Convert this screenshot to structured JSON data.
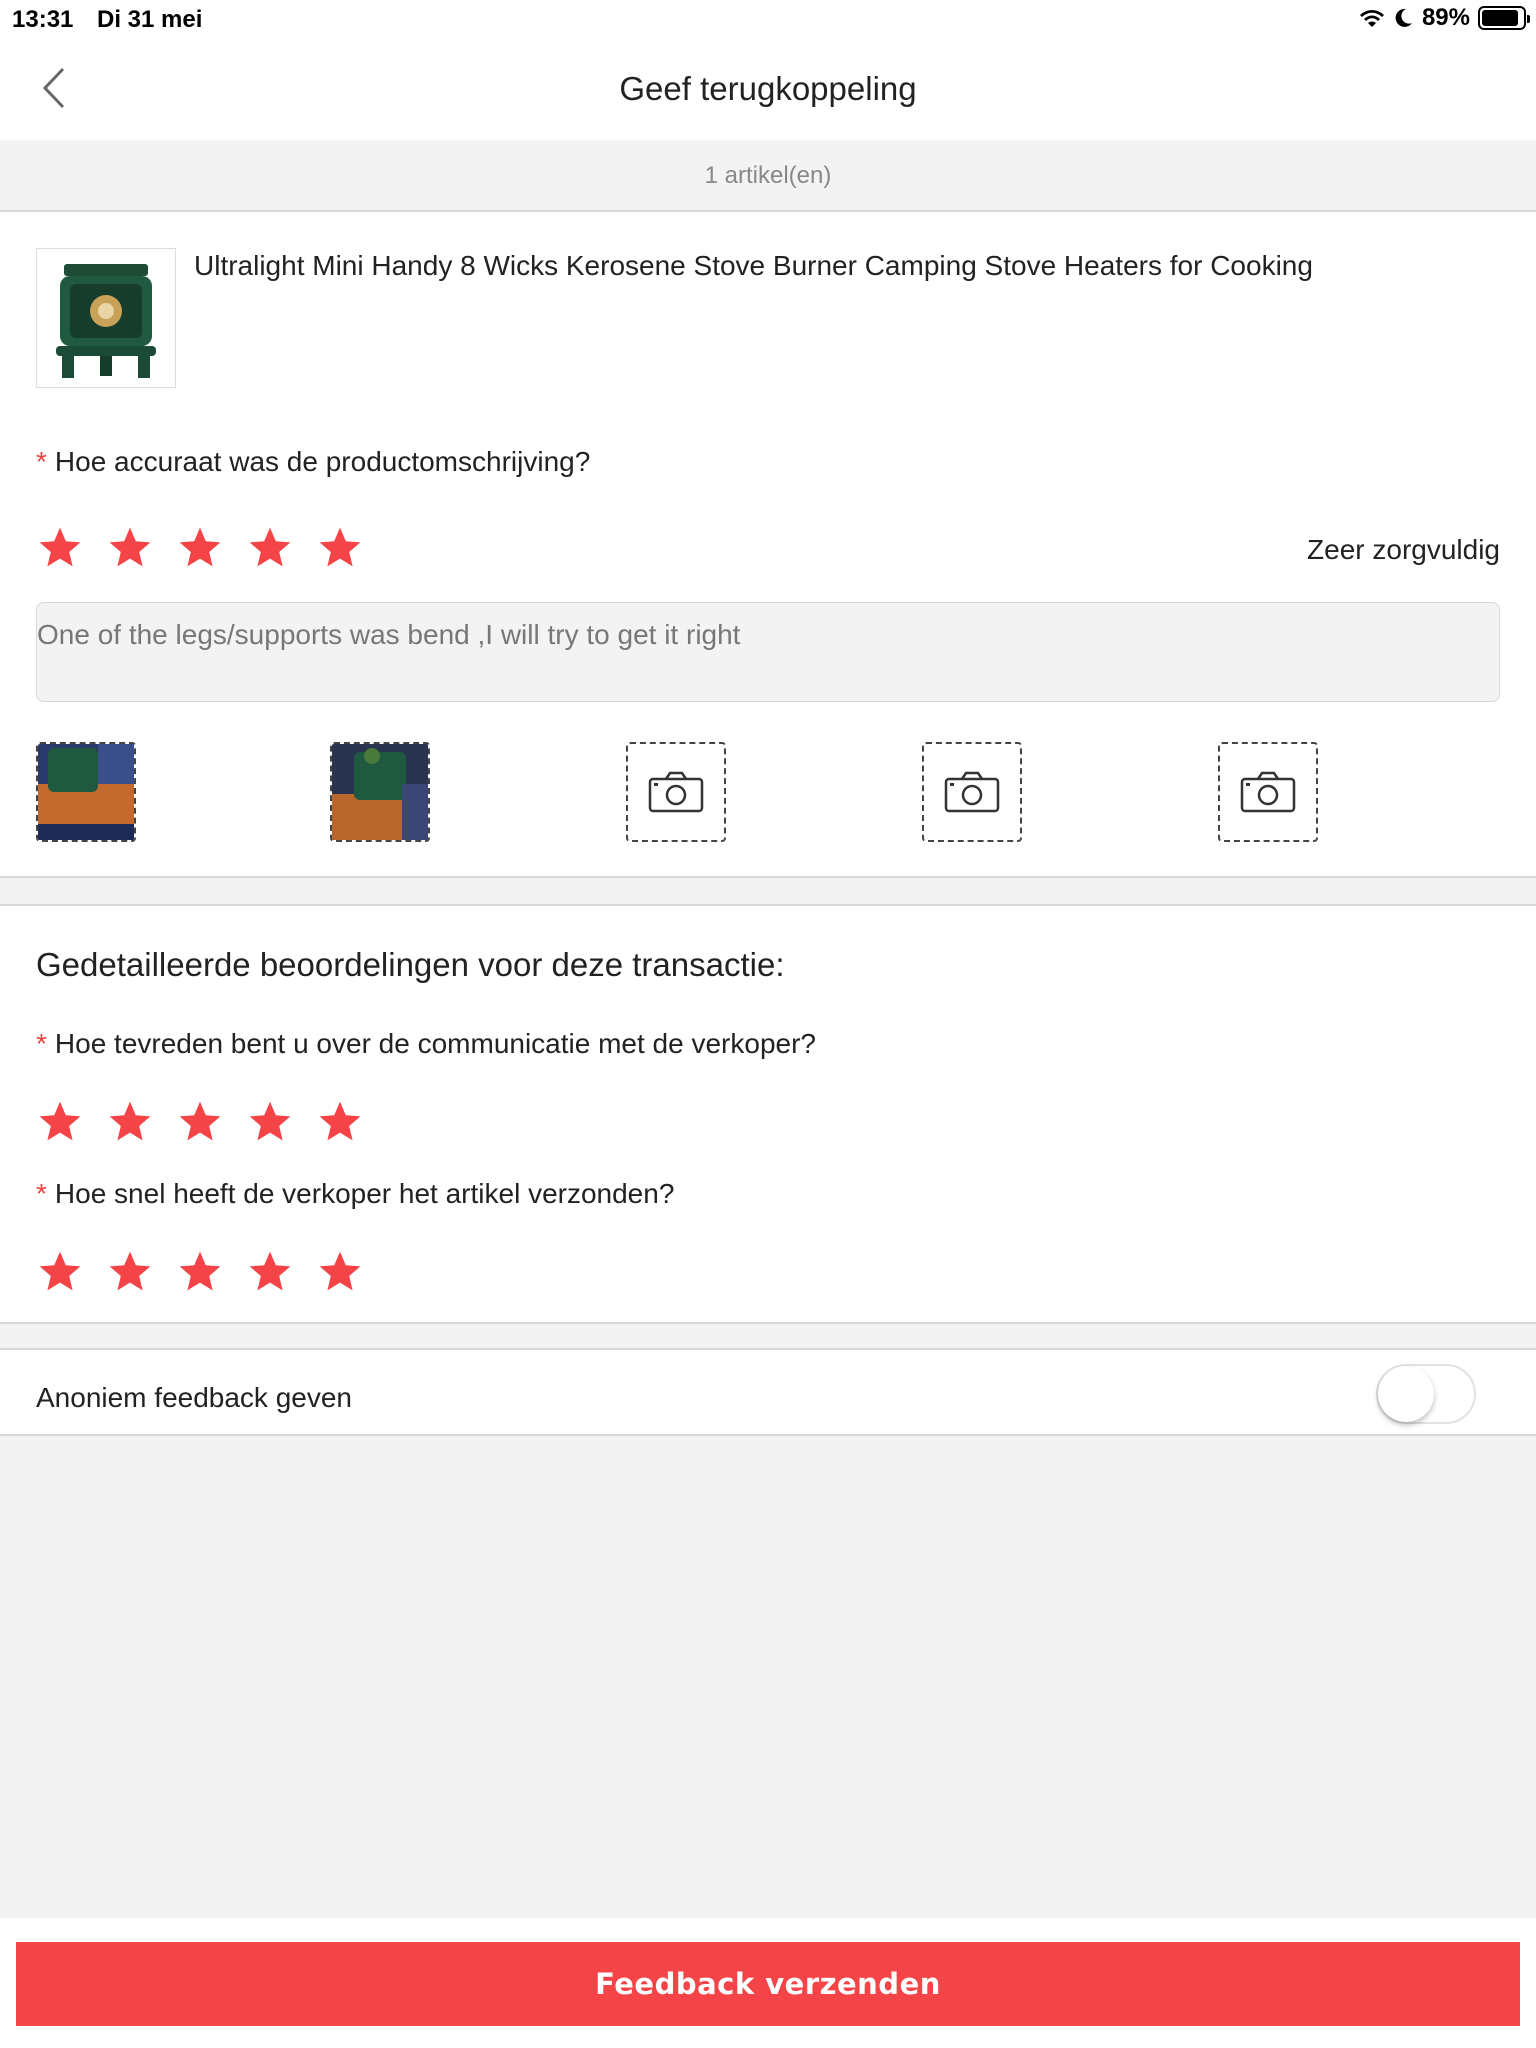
{
  "status_bar": {
    "time": "13:31",
    "date": "Di 31 mei",
    "battery": "89%",
    "battery_level": 0.89
  },
  "nav": {
    "title": "Geef terugkoppeling",
    "back_icon": "chevron-left-icon"
  },
  "item_count": "1 artikel(en)",
  "product": {
    "title": "Ultralight Mini Handy 8 Wicks Kerosene Stove Burner Camping Stove Heaters for Cooking"
  },
  "accuracy": {
    "required_mark": "*",
    "question": "Hoe accuraat was de productomschrijving?",
    "rating": 5,
    "rating_label": "Zeer zorgvuldig",
    "review_text": "One of the legs/supports was bend ,I will try to get it right"
  },
  "photos": {
    "uploaded": 2,
    "empty_slots": 3,
    "camera_icon": "camera-icon"
  },
  "detailed": {
    "heading": "Gedetailleerde beoordelingen voor deze transactie:",
    "communication": {
      "required_mark": "*",
      "question": "Hoe tevreden bent u over de communicatie met de verkoper?",
      "rating": 5
    },
    "shipping": {
      "required_mark": "*",
      "question": "Hoe snel heeft de verkoper het artikel verzonden?",
      "rating": 5
    }
  },
  "anonymous": {
    "label": "Anoniem feedback geven",
    "enabled": false
  },
  "submit": {
    "label": "Feedback verzenden"
  },
  "colors": {
    "accent": "#f54448",
    "star": "#f54448"
  }
}
